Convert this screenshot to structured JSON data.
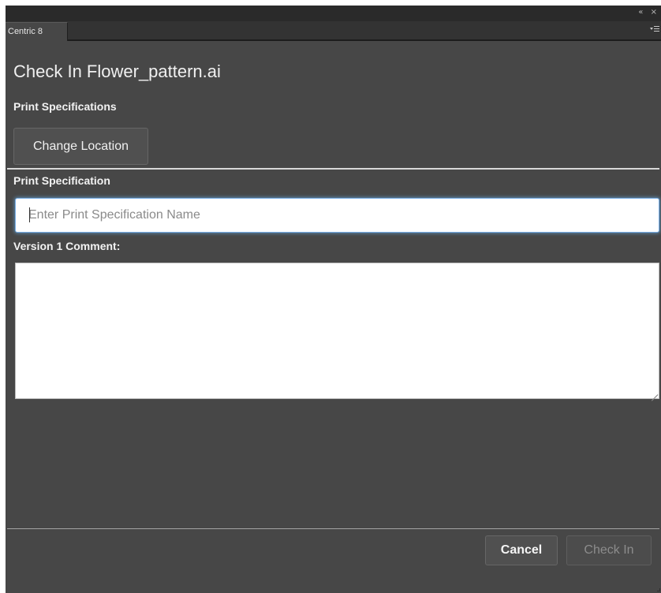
{
  "panel": {
    "controls": {
      "collapse_glyph": "«",
      "close_glyph": "×"
    },
    "tab_label": "Centric 8",
    "menu_icon": "panel-flyout-menu-icon"
  },
  "dialog": {
    "title": "Check In Flower_pattern.ai",
    "section_heading": "Print Specifications",
    "change_location_label": "Change Location",
    "print_spec_label": "Print Specification",
    "print_spec_input": {
      "value": "",
      "placeholder": "Enter Print Specification Name"
    },
    "comment_label": "Version 1 Comment:",
    "comment_value": ""
  },
  "footer": {
    "cancel_label": "Cancel",
    "check_in_label": "Check In",
    "check_in_enabled": false
  },
  "colors": {
    "panel_bg": "#474747",
    "title_bar": "#2a2a2a",
    "input_focus": "#66afe9"
  }
}
